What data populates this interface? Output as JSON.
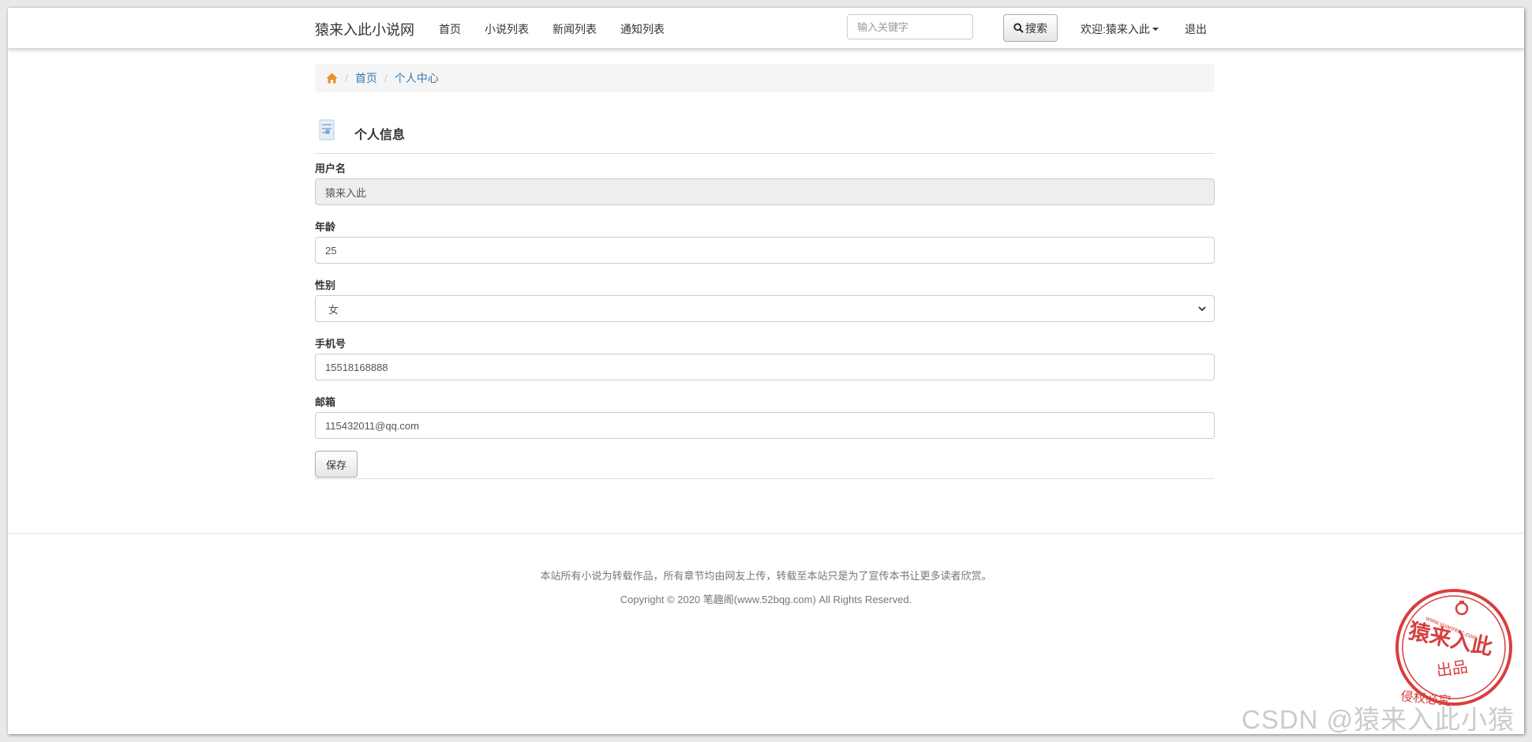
{
  "navbar": {
    "brand": "猿来入此小说网",
    "links": [
      "首页",
      "小说列表",
      "新闻列表",
      "通知列表"
    ],
    "search_placeholder": "输入关键字",
    "search_label": "搜索",
    "welcome": "欢迎:猿来入此",
    "logout": "退出"
  },
  "breadcrumb": {
    "items": [
      "首页",
      "个人中心"
    ]
  },
  "section": {
    "title": "个人信息"
  },
  "form": {
    "username": {
      "label": "用户名",
      "value": "猿来入此"
    },
    "age": {
      "label": "年龄",
      "value": "25"
    },
    "gender": {
      "label": "性别",
      "value": "女"
    },
    "phone": {
      "label": "手机号",
      "value": "15518168888"
    },
    "email": {
      "label": "邮箱",
      "value": "115432011@qq.com"
    },
    "save_label": "保存"
  },
  "footer": {
    "notice": "本站所有小说为转载作品，所有章节均由网友上传，转载至本站只是为了宣传本书让更多读者欣赏。",
    "copyright": "Copyright © 2020 笔趣阁(www.52bqg.com) All Rights Reserved."
  },
  "stamp": {
    "text": "猿来入此",
    "subtext": "出品",
    "url": "www.yuanrenc.com",
    "bottom_text": "侵权必究"
  },
  "watermark": "CSDN @猿来入此小猿",
  "colors": {
    "link": "#337ab7",
    "home_icon": "#e8912a",
    "stamp": "#d42a2a"
  },
  "icons": {
    "home": "home-icon",
    "search": "search-icon",
    "document": "document-icon",
    "dropdown": "chevron-down-icon"
  }
}
